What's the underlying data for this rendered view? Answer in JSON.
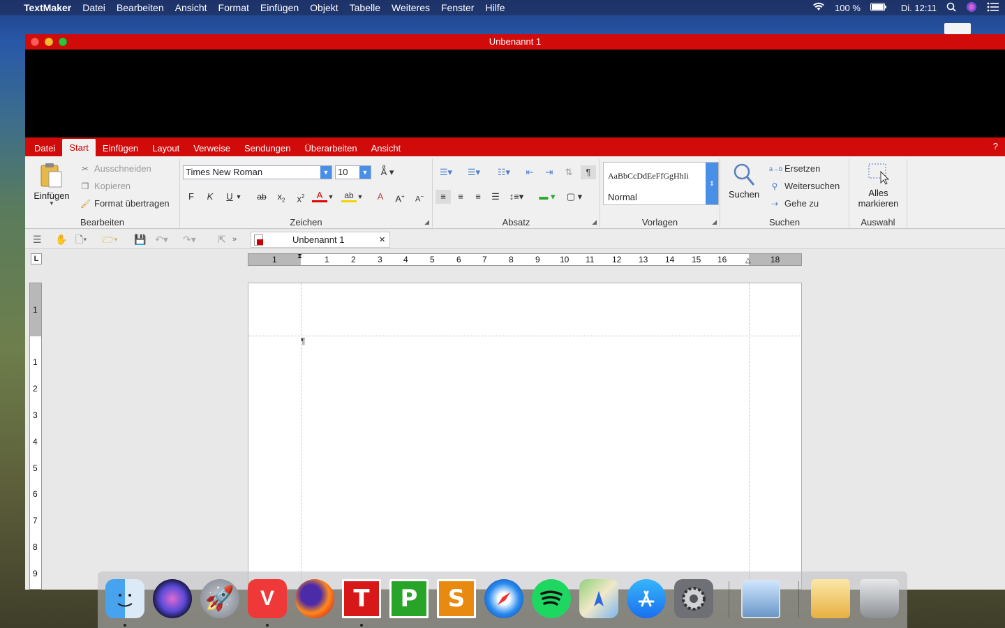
{
  "menubar": {
    "apple": "",
    "app": "TextMaker",
    "items": [
      "Datei",
      "Bearbeiten",
      "Ansicht",
      "Format",
      "Einfügen",
      "Objekt",
      "Tabelle",
      "Weiteres",
      "Fenster",
      "Hilfe"
    ],
    "battery": "100 %",
    "clock": "Di. 12:11"
  },
  "window": {
    "title": "Unbenannt 1"
  },
  "ribbon_tabs": [
    "Datei",
    "Start",
    "Einfügen",
    "Layout",
    "Verweise",
    "Sendungen",
    "Überarbeiten",
    "Ansicht"
  ],
  "help": "?",
  "groups": {
    "bearbeiten": {
      "label": "Bearbeiten",
      "paste": "Einfügen",
      "cut": "Ausschneiden",
      "copy": "Kopieren",
      "format_painter": "Format übertragen"
    },
    "zeichen": {
      "label": "Zeichen",
      "font": "Times New Roman",
      "size": "10",
      "bold": "F",
      "italic": "K",
      "underline": "U"
    },
    "absatz": {
      "label": "Absatz",
      "pilcrow": "¶"
    },
    "vorlagen": {
      "label": "Vorlagen",
      "preview": "AaBbCcDdEeFfGgHhIi",
      "style": "Normal"
    },
    "suchen": {
      "label": "Suchen",
      "search": "Suchen",
      "replace": "Ersetzen",
      "find_next": "Weitersuchen",
      "goto": "Gehe zu"
    },
    "auswahl": {
      "label": "Auswahl",
      "select_all_1": "Alles",
      "select_all_2": "markieren"
    }
  },
  "doc_tab": {
    "title": "Unbenannt 1",
    "close": "×"
  },
  "ruler": {
    "h": [
      "1",
      "1",
      "2",
      "3",
      "4",
      "5",
      "6",
      "7",
      "8",
      "9",
      "10",
      "11",
      "12",
      "13",
      "14",
      "15",
      "16",
      "18"
    ],
    "v": [
      "1",
      "1",
      "2",
      "3",
      "4",
      "5",
      "6",
      "7",
      "8",
      "9"
    ]
  },
  "corner": "L",
  "paragraph_mark": "¶",
  "dock": {
    "vivaldi": "V",
    "textmaker": "T",
    "presentations": "P",
    "planmaker": "S"
  }
}
